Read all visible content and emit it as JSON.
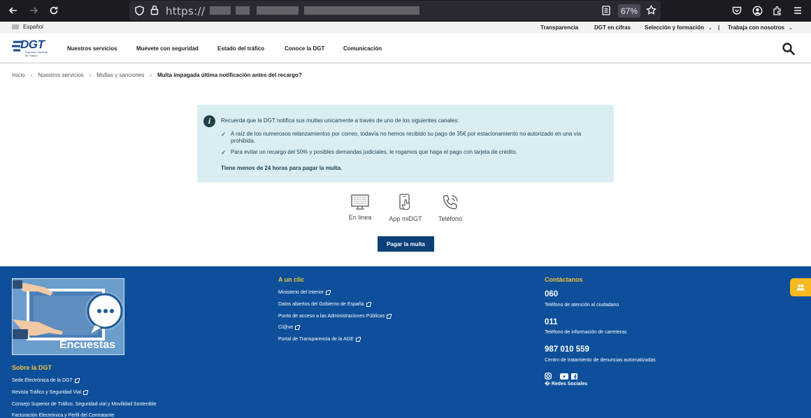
{
  "browser": {
    "url_prefix": "https://",
    "zoom": "67%"
  },
  "utility_bar": {
    "language": "Español",
    "links": [
      "Transparencia",
      "DGT en cifras",
      "Selección y formación",
      "Trabaja con nosotros"
    ]
  },
  "header": {
    "logo_text": "DGT",
    "logo_subtitle": "Dirección General de Tráfico",
    "nav": [
      "Nuestros servicios",
      "Muévete con seguridad",
      "Estado del tráfico",
      "Conoce la DGT",
      "Comunicación"
    ]
  },
  "breadcrumb": {
    "items": [
      "Inicio",
      "Nuestros servicios",
      "Multas y sanciones"
    ],
    "current": "Multa impagada última notificación antes del recargo?"
  },
  "notice": {
    "intro": "Recuerda que la DGT notifica sus multas unicamente a través de uno de los siguientes canales:",
    "items": [
      "A raíz de los numerosos relanzamientos por correo, todavía no hemos recibido su pago de 35€ por estacionamiento no autorizado en una vía prohibida.",
      "Para evitar un recargo del 50% y posibles demandas judiciales, le rogamos que haga el pago con tarjeta de crédito."
    ],
    "warning": "Tiene menos de 24 horas para pagar la multa."
  },
  "channels": [
    {
      "label": "En linea",
      "icon": "monitor-icon"
    },
    {
      "label": "App miDGT",
      "icon": "mobile-touch-icon"
    },
    {
      "label": "Teléfono",
      "icon": "phone-icon"
    }
  ],
  "pay_button": "Pagar la multa",
  "footer": {
    "encuestas": "Encuestas",
    "about_heading": "Sobre la DGT",
    "about_links": [
      "Sede Electrónica de la DGT",
      "Revista Tráfico y Seguridad Vial",
      "Consejo Superior de Tráfico, Seguridad vial y Movilidad Sostenible",
      "Facturación Electrónica y Perfil del Contratante"
    ],
    "quick_heading": "A un clic",
    "quick_links": [
      "Ministerio del Interior",
      "Datos abiertos del Gobierno de España",
      "Punto de acceso a las Administraciones Públicas",
      "Cl@ve",
      "Portal de Transparencia de la AGE"
    ],
    "contact_heading": "Contáctanos",
    "contacts": [
      {
        "number": "060",
        "desc": "Teléfono de atención al ciudadano"
      },
      {
        "number": "011",
        "desc": "Teléfono de información de carreteras"
      },
      {
        "number": "987 010 559",
        "desc": "Centro de tratamiento de denuncias automatizadas"
      }
    ],
    "social_label": "� Redes Sociales"
  },
  "colors": {
    "brand_blue": "#0d4f9a",
    "button_blue": "#0c3f78",
    "accent_yellow": "#f3c23c",
    "notice_bg": "#daeef2"
  }
}
